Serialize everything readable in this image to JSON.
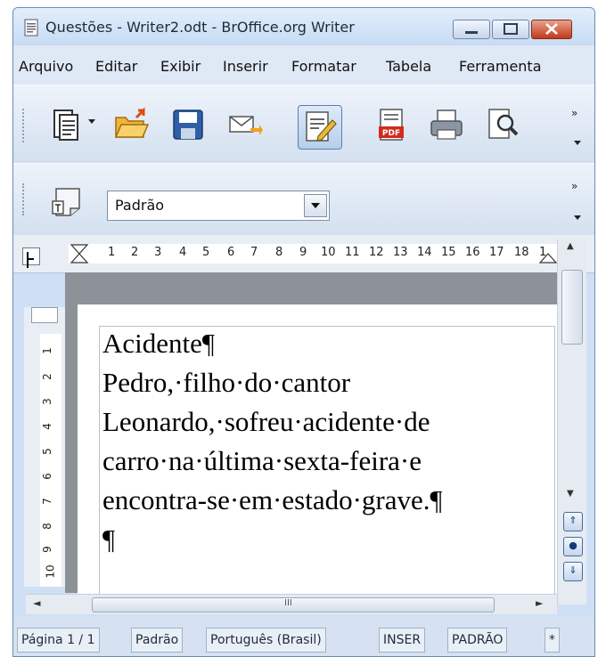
{
  "window": {
    "title": "Questões - Writer2.odt - BrOffice.org Writer"
  },
  "menu": {
    "items": [
      "Arquivo",
      "Editar",
      "Exibir",
      "Inserir",
      "Formatar",
      "Tabela",
      "Ferramenta"
    ]
  },
  "toolbar": {
    "overflow_label": "»"
  },
  "formatting": {
    "paragraph_style": "Padrão",
    "overflow_label": "»"
  },
  "ruler": {
    "numbers": [
      "1",
      "2",
      "3",
      "4",
      "5",
      "6",
      "7",
      "8",
      "9",
      "10",
      "11",
      "12",
      "13",
      "14",
      "15",
      "16",
      "17",
      "18",
      "1"
    ]
  },
  "vertical_ruler": {
    "numbers": [
      "1",
      "2",
      "3",
      "4",
      "5",
      "6",
      "7",
      "8",
      "9",
      "10"
    ]
  },
  "document": {
    "paragraphs": [
      "Acidente¶",
      "Pedro,·filho·do·cantor",
      "Leonardo,·sofreu·acidente·de",
      "carro·na·última·sexta-feira·e",
      "encontra-se·em·estado·grave.¶",
      "¶"
    ]
  },
  "scrollbar": {
    "up_arrow": "▲",
    "down_arrow": "▼",
    "left_arrow": "◄",
    "right_arrow": "►",
    "grip": "III",
    "nav_prev": "⇑",
    "nav_object": "●",
    "nav_next": "⇓"
  },
  "status": {
    "page": "Página 1 / 1",
    "page_style": "Padrão",
    "language": "Português (Brasil)",
    "insert_mode": "INSER",
    "selection_mode": "PADRÃO",
    "modified": "*"
  }
}
